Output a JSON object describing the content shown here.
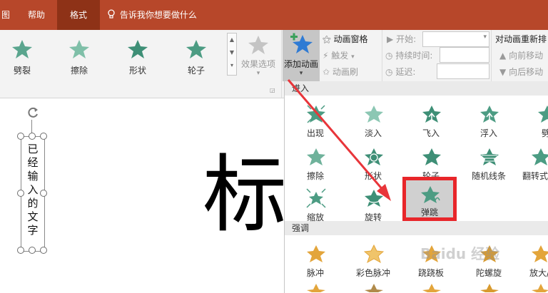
{
  "tabs": {
    "partial_left": "图",
    "help": "帮助",
    "format": "格式",
    "tell_me": "告诉我你想要做什么"
  },
  "ribbon": {
    "effects": [
      {
        "label": "劈裂",
        "icon": "split-star-icon"
      },
      {
        "label": "擦除",
        "icon": "wipe-star-icon"
      },
      {
        "label": "形状",
        "icon": "shape-star-icon"
      },
      {
        "label": "轮子",
        "icon": "wheel-star-icon"
      }
    ],
    "effect_options": "效果选项",
    "add_animation": "添加动画",
    "animation_pane": "动画窗格",
    "trigger": "触发",
    "animation_painter": "动画刷",
    "start_label": "开始:",
    "duration_label": "持续时间:",
    "delay_label": "延迟:",
    "reorder_title": "对动画重新排",
    "move_earlier": "向前移动",
    "move_later": "向后移动"
  },
  "slide": {
    "vertical_text": "已经输入的文字",
    "title_partial": "标"
  },
  "panel": {
    "entrance_header": "进入",
    "emphasis_header": "强调",
    "entrance": [
      "出现",
      "淡入",
      "飞入",
      "浮入",
      "劈",
      "擦除",
      "形状",
      "轮子",
      "随机线条",
      "翻转式",
      "缩放",
      "旋转",
      "弹跳"
    ],
    "emphasis": [
      "脉冲",
      "彩色脉冲",
      "跷跷板",
      "陀螺旋",
      "放大/"
    ]
  },
  "watermark": "Baidu 经验",
  "colors": {
    "tab_bg": "#b7472a",
    "tab_active": "#8e3217",
    "star_green": "#5aa58e",
    "star_blue": "#2f7bd4",
    "star_gold": "#e3a53b",
    "highlight_red": "#e8262a",
    "arrow_red": "#e8353a"
  }
}
